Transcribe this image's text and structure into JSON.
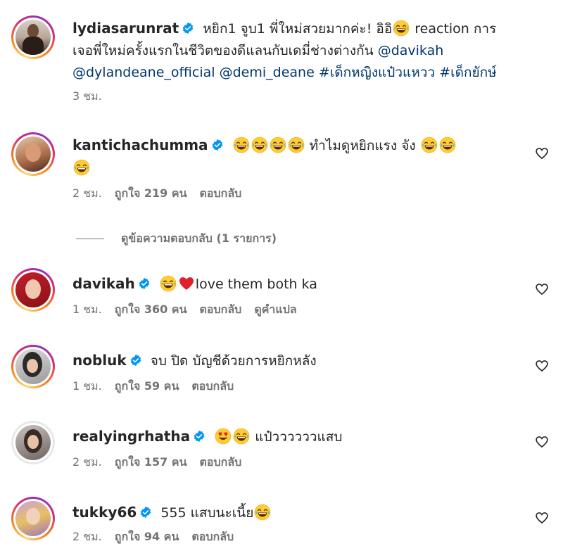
{
  "post": {
    "username": "lydiasarunrat",
    "caption_line1": "หยิก1 จูบ1 พี่ใหม่สวยมากค่ะ! อิอิ",
    "caption_line1b": " reaction การ",
    "caption_line2": "เจอพี่ใหม่ครั้งแรกในชีวิตของดีแลนกับเดมี่ช่างต่างกัน ",
    "tag1": "@davikah",
    "tag2": "@dylandeane_official",
    "tag3": "@demi_deane",
    "tag4": "#เด็กหญิงแป๋วแหวว",
    "tag5": "#เด็กยักษ์",
    "time": "3 ชม."
  },
  "comments": [
    {
      "username": "kanticha​chumma",
      "text": "ทำไมดูหยิกแรง จัง",
      "time": "2 ชม.",
      "likes": "ถูกใจ 219 คน",
      "reply": "ตอบกลับ"
    },
    {
      "username": "davikah",
      "text": "love them both ka",
      "time": "1 ชม.",
      "likes": "ถูกใจ 360 คน",
      "reply": "ตอบกลับ",
      "translate": "ดูคำแปล"
    },
    {
      "username": "nobluk",
      "text": "จบ ปิด บัญชีด้วยการหยิกหลัง",
      "time": "1 ชม.",
      "likes": "ถูกใจ 59 คน",
      "reply": "ตอบกลับ"
    },
    {
      "username": "realyingrhatha",
      "text": "แป๋ววววววแสบ",
      "time": "2 ชม.",
      "likes": "ถูกใจ 157 คน",
      "reply": "ตอบกลับ"
    },
    {
      "username": "tukky66",
      "text": "555 แสบนะเนี้ย",
      "time": "2 ชม.",
      "likes": "ถูกใจ 94 คน",
      "reply": "ตอบกลับ"
    }
  ],
  "view_replies": "ดูข้อความตอบกลับ (1 รายการ)",
  "icons": {
    "verified": "verified-badge-icon",
    "heart": "heart-outline-icon",
    "laugh": "tears-of-joy-emoji",
    "red_heart": "red-heart-emoji",
    "heart_eyes": "heart-eyes-emoji"
  },
  "colors": {
    "verified": "#0095f6",
    "tag": "#00376b",
    "meta": "#737373"
  }
}
